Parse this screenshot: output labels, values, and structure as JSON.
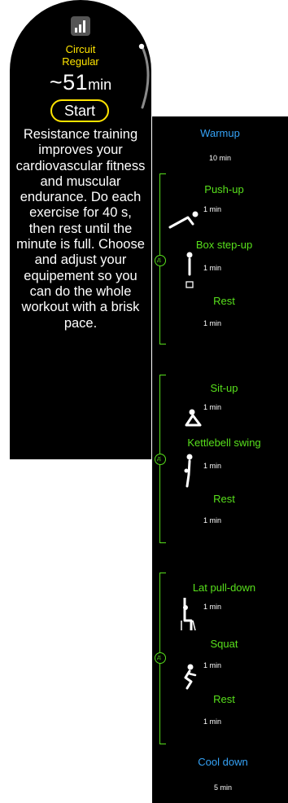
{
  "workout": {
    "level_icon": "bar-chart-icon",
    "title_line1": "Circuit",
    "title_line2": "Regular",
    "duration_value": "~51",
    "duration_unit": "min",
    "start_label": "Start",
    "description": "Resistance training improves your cardiovascular fitness and muscular endurance. Do each exercise for 40 s, then rest until the minute is full. Choose and adjust your equipement so you can do the whole workout with a brisk pace."
  },
  "phases": {
    "warmup": {
      "name": "Warmup",
      "time": "10 min"
    },
    "cooldown": {
      "name": "Cool down",
      "time": "5 min"
    }
  },
  "rounds": [
    {
      "badge": "3x",
      "exercises": [
        {
          "name": "Push-up",
          "time": "1 min",
          "icon": "push-up-icon"
        },
        {
          "name": "Box step-up",
          "time": "1 min",
          "icon": "box-step-up-icon"
        },
        {
          "name": "Rest",
          "time": "1 min"
        }
      ]
    },
    {
      "badge": "3x",
      "exercises": [
        {
          "name": "Sit-up",
          "time": "1 min",
          "icon": "sit-up-icon"
        },
        {
          "name": "Kettlebell swing",
          "time": "1 min",
          "icon": "kettlebell-swing-icon"
        },
        {
          "name": "Rest",
          "time": "1 min"
        }
      ]
    },
    {
      "badge": "3x",
      "exercises": [
        {
          "name": "Lat pull-down",
          "time": "1 min",
          "icon": "lat-pull-down-icon"
        },
        {
          "name": "Squat",
          "time": "1 min",
          "icon": "squat-icon"
        },
        {
          "name": "Rest",
          "time": "1 min"
        }
      ]
    }
  ],
  "colors": {
    "accent": "#ffe400",
    "phase_title": "#35a2f6",
    "exercise_title": "#58e01c",
    "background": "#000000"
  }
}
